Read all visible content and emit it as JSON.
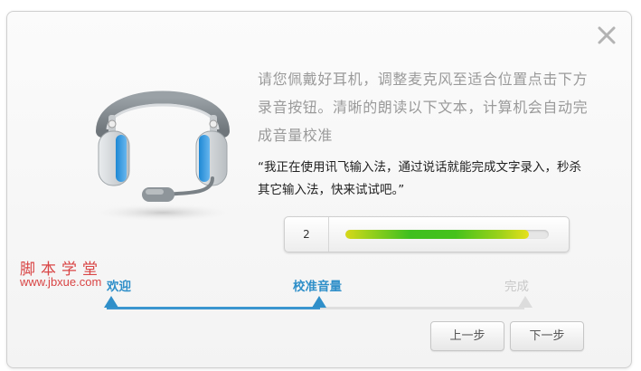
{
  "dialog": {
    "instruction": "请您佩戴好耳机，调整麦克风至适合位置点击下方录音按钮。清晰的朗读以下文本，计算机会自动完成音量校准",
    "quote": "“我正在使用讯飞输入法，通过说话就能完成文字录入，秒杀其它输入法，快来试试吧。”"
  },
  "volume_meter": {
    "value": "2",
    "level_fraction": 0.9
  },
  "steps": [
    {
      "label": "欢迎",
      "state": "done"
    },
    {
      "label": "校准音量",
      "state": "current"
    },
    {
      "label": "完成",
      "state": "pending"
    }
  ],
  "buttons": {
    "prev_label": "上一步",
    "next_label": "下一步"
  },
  "watermark": {
    "name": "脚本学堂",
    "url": "www.jbxue.com"
  },
  "icons": {
    "close": "close-icon",
    "headset": "headset-icon"
  },
  "colors": {
    "accent": "#2f8fc9",
    "watermark": "#d94545",
    "pending": "#c8c8c8"
  }
}
